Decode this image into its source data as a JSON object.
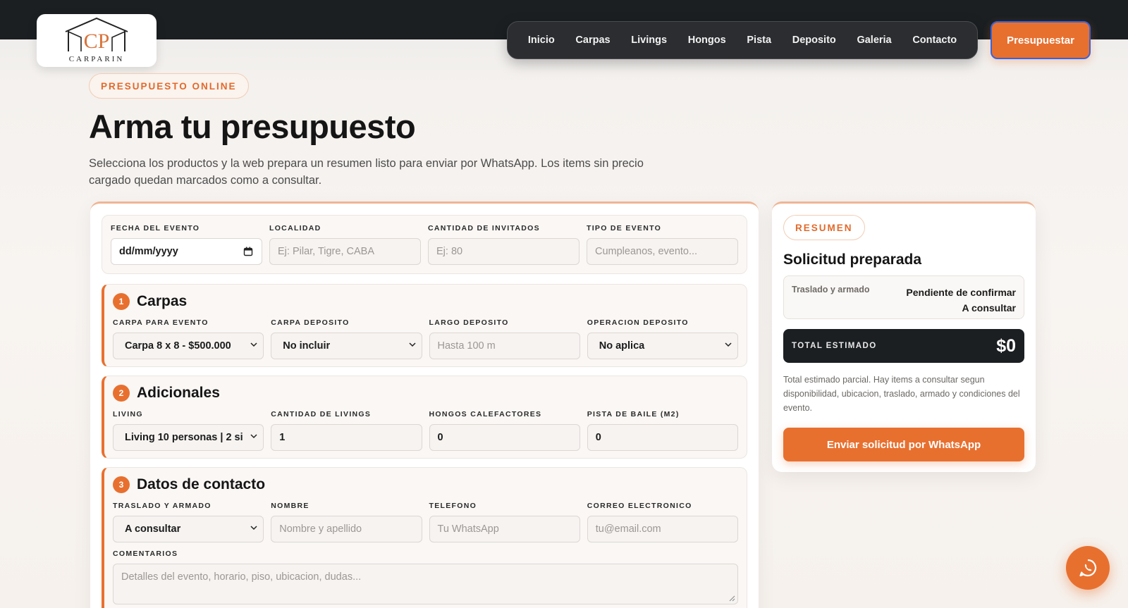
{
  "brand": {
    "logo_text": "CARPARIN",
    "monogram": "CP"
  },
  "nav": {
    "items": [
      "Inicio",
      "Carpas",
      "Livings",
      "Hongos",
      "Pista",
      "Deposito",
      "Galeria",
      "Contacto"
    ]
  },
  "cta_label": "Presupuestar",
  "hero": {
    "eyebrow": "PRESUPUESTO ONLINE",
    "title": "Arma tu presupuesto",
    "lead": "Selecciona los productos y la web prepara un resumen listo para enviar por WhatsApp. Los items sin precio cargado quedan marcados como a consultar."
  },
  "event": {
    "fecha": {
      "label": "FECHA DEL EVENTO",
      "value": "dd/mm/yyyy"
    },
    "localidad": {
      "label": "LOCALIDAD",
      "placeholder": "Ej: Pilar, Tigre, CABA"
    },
    "invitados": {
      "label": "CANTIDAD DE INVITADOS",
      "placeholder": "Ej: 80"
    },
    "tipo": {
      "label": "TIPO DE EVENTO",
      "placeholder": "Cumpleanos, evento..."
    }
  },
  "sections": {
    "carpas": {
      "number": "1",
      "title": "Carpas",
      "carpa_evento": {
        "label": "CARPA PARA EVENTO",
        "value": "Carpa 8 x 8 - $500.000"
      },
      "carpa_deposito": {
        "label": "CARPA DEPOSITO",
        "value": "No incluir"
      },
      "largo_deposito": {
        "label": "LARGO DEPOSITO",
        "placeholder": "Hasta 100 m"
      },
      "operacion_deposito": {
        "label": "OPERACION DEPOSITO",
        "value": "No aplica"
      }
    },
    "adicionales": {
      "number": "2",
      "title": "Adicionales",
      "living": {
        "label": "LIVING",
        "value": "Living 10 personas | 2 si"
      },
      "cantidad_livings": {
        "label": "CANTIDAD DE LIVINGS",
        "value": "1"
      },
      "hongos": {
        "label": "HONGOS CALEFACTORES",
        "value": "0"
      },
      "pista": {
        "label": "PISTA DE BAILE (M2)",
        "value": "0"
      }
    },
    "contacto": {
      "number": "3",
      "title": "Datos de contacto",
      "traslado": {
        "label": "TRASLADO Y ARMADO",
        "value": "A consultar"
      },
      "nombre": {
        "label": "NOMBRE",
        "placeholder": "Nombre y apellido"
      },
      "telefono": {
        "label": "TELEFONO",
        "placeholder": "Tu WhatsApp"
      },
      "correo": {
        "label": "CORREO ELECTRONICO",
        "placeholder": "tu@email.com"
      },
      "comentarios": {
        "label": "COMENTARIOS",
        "placeholder": "Detalles del evento, horario, piso, ubicacion, dudas..."
      }
    }
  },
  "summary": {
    "pill": "RESUMEN",
    "title": "Solicitud preparada",
    "row_key": "Traslado y armado",
    "row_value_1": "Pendiente de confirmar",
    "row_value_2": "A consultar",
    "total_label": "TOTAL ESTIMADO",
    "total_value": "$0",
    "note": "Total estimado parcial. Hay items a consultar segun disponibilidad, ubicacion, traslado, armado y condiciones del evento.",
    "button": "Enviar solicitud por WhatsApp"
  },
  "icons": {
    "calendar": "calendar-icon",
    "chevron": "chevron-down-icon",
    "whatsapp": "whatsapp-icon"
  },
  "colors": {
    "accent": "#e8702f",
    "dark": "#1b1f22",
    "outline": "#3a63d8"
  }
}
